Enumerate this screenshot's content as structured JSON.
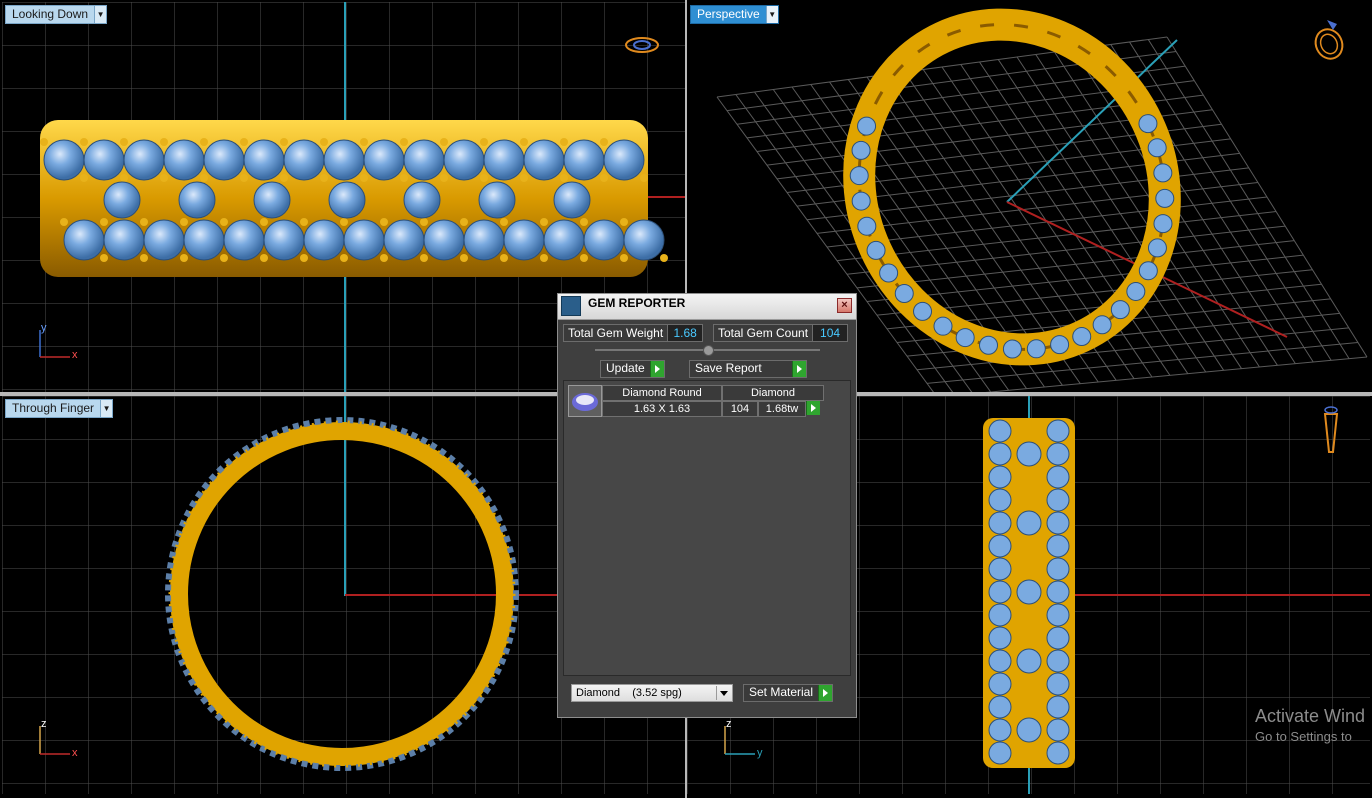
{
  "viewports": {
    "top_left": {
      "label": "Looking Down"
    },
    "top_right": {
      "label": "Perspective"
    },
    "bottom_left": {
      "label": "Through Finger"
    },
    "bottom_right": {
      "label": ""
    }
  },
  "axes": {
    "top_left": {
      "vertical": "y",
      "horizontal": "x"
    },
    "bottom_left": {
      "vertical": "z",
      "horizontal": "x"
    },
    "bottom_right": {
      "vertical": "z",
      "horizontal": "y"
    }
  },
  "gem_reporter": {
    "title": "GEM REPORTER",
    "close_glyph": "×",
    "total_weight_label": "Total Gem Weight",
    "total_weight_value": "1.68",
    "total_count_label": "Total Gem Count",
    "total_count_value": "104",
    "update_label": "Update",
    "save_report_label": "Save Report",
    "gems": [
      {
        "shape": "Diamond Round",
        "material": "Diamond",
        "size": "1.63 X 1.63",
        "count": "104",
        "weight": "1.68tw"
      }
    ],
    "material_select_value": "Diamond    (3.52 spg)",
    "set_material_label": "Set Material"
  },
  "watermark": {
    "line1": "Activate Wind",
    "line2": "Go to Settings to"
  },
  "colors": {
    "gold": "#e0a400",
    "gem_blue": "#6b9fd6",
    "grid": "#5a5a5a",
    "axis_cyan": "#2aa0b8",
    "axis_red": "#b02020",
    "active_tab": "#2f8fd3"
  }
}
